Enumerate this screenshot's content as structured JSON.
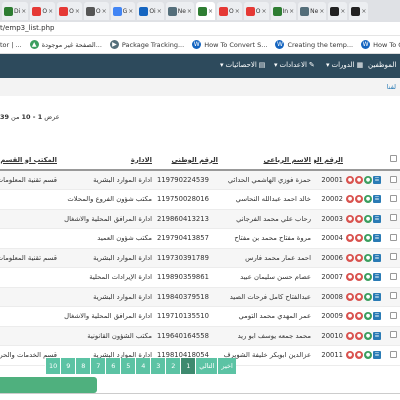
{
  "browser": {
    "tabs": [
      {
        "label": "Di",
        "color": "#2e7d32",
        "close": "×",
        "active": false
      },
      {
        "label": "O",
        "color": "#e53935",
        "close": "×",
        "active": false
      },
      {
        "label": "O",
        "color": "#e53935",
        "close": "×",
        "active": false
      },
      {
        "label": "O",
        "color": "#555555",
        "close": "×",
        "active": false
      },
      {
        "label": "G",
        "color": "#4285f4",
        "close": "×",
        "active": false
      },
      {
        "label": "Oi",
        "color": "#1565c0",
        "close": "×",
        "active": false
      },
      {
        "label": "Ne",
        "color": "#546e7a",
        "close": "×",
        "active": false
      },
      {
        "label": "",
        "color": "#2e7d32",
        "close": "×",
        "active": true
      },
      {
        "label": "O",
        "color": "#e53935",
        "close": "×",
        "active": false
      },
      {
        "label": "O",
        "color": "#e53935",
        "close": "×",
        "active": false
      },
      {
        "label": "In",
        "color": "#2e7d32",
        "close": "×",
        "active": false
      },
      {
        "label": "Ne",
        "color": "#546e7a",
        "close": "×",
        "active": false
      },
      {
        "label": "",
        "color": "#222222",
        "close": "×",
        "active": false
      },
      {
        "label": "",
        "color": "#222222",
        "close": "×",
        "active": false
      }
    ],
    "url": "t/emp3_list.php"
  },
  "bookmarks": [
    {
      "label": "tor | ...",
      "icon": "",
      "color": "#ffffff"
    },
    {
      "label": "الصفحة غير موجودة...",
      "icon": "▲",
      "color": "#3c9e5f"
    },
    {
      "label": "Package Tracking...",
      "icon": "▶",
      "color": "#546e7a"
    },
    {
      "label": "How To Convert S...",
      "icon": "W",
      "color": "#1565c0"
    },
    {
      "label": "Creating the temp...",
      "icon": "W",
      "color": "#1565c0"
    },
    {
      "label": "How To Create Im...",
      "icon": "W",
      "color": "#1565c0"
    }
  ],
  "navbar": {
    "employees": "الموظفين",
    "courses": "الدورات",
    "settings": "الاعدادات",
    "statistics": "الاحصائيات"
  },
  "breadcrumb": "لفنا",
  "counter": {
    "prefix": "عرض",
    "range": "1 - 10",
    "of": "من",
    "total": "39"
  },
  "table": {
    "headers": {
      "emp_no": "الرقم الوظيفي",
      "name": "الاسم الرباعي",
      "national_id": "الرقم الوطني",
      "department": "الادارة",
      "office": "المكتب او القسم"
    },
    "rows": [
      {
        "emp_no": "20001",
        "name": "حمزة فوزي الهاشمي الحداثي",
        "national_id": "119790224539",
        "department": "ادارة الموارد البشرية",
        "office": "قسم تقنية المعلومات"
      },
      {
        "emp_no": "20002",
        "name": "خالد احمد عبدالله النحاسي",
        "national_id": "119750028016",
        "department": "مكتب شؤون الفروع والمحلات",
        "office": ""
      },
      {
        "emp_no": "20003",
        "name": "رحاب علي محمد الفرجاني",
        "national_id": "219860413213",
        "department": "ادارة المرافق المحلية والاشغال",
        "office": ""
      },
      {
        "emp_no": "20004",
        "name": "مروة مفتاح محمد بن مفتاح",
        "national_id": "219790413857",
        "department": "مكتب شؤون العميد",
        "office": ""
      },
      {
        "emp_no": "20006",
        "name": "احمد عمار محمد فارس",
        "national_id": "119730391789",
        "department": "ادارة الموارد البشرية",
        "office": "قسم تقنية المعلومات"
      },
      {
        "emp_no": "20007",
        "name": "عصام حسن سليمان عبيد",
        "national_id": "119890359861",
        "department": "ادارة الإيرادات المحلية",
        "office": ""
      },
      {
        "emp_no": "20008",
        "name": "عبدالفتاح كامل فرحات الصيد",
        "national_id": "119840379518",
        "department": "ادارة الموارد البشرية",
        "office": ""
      },
      {
        "emp_no": "20009",
        "name": "عمر المهدي محمد التومي",
        "national_id": "119710135510",
        "department": "ادارة المرافق المحلية والاشغال",
        "office": ""
      },
      {
        "emp_no": "20010",
        "name": "محمد جمعه يوسف ابو ريد",
        "national_id": "119640164558",
        "department": "مكتب الشؤون القانونية",
        "office": ""
      },
      {
        "emp_no": "20011",
        "name": "عزالدين ابوبكر خليفة الشويرف",
        "national_id": "119810418054",
        "department": "ادارة الموارد البشرية",
        "office": "قسم الخدمات والحركة"
      }
    ],
    "action_icons": {
      "red": "●",
      "green": "●",
      "blue": "☰"
    }
  },
  "pagination": {
    "last": "اخير",
    "next": "التالي",
    "pages": [
      "1",
      "2",
      "3",
      "4",
      "5",
      "6",
      "7",
      "8",
      "9",
      "10"
    ],
    "current": "1"
  }
}
